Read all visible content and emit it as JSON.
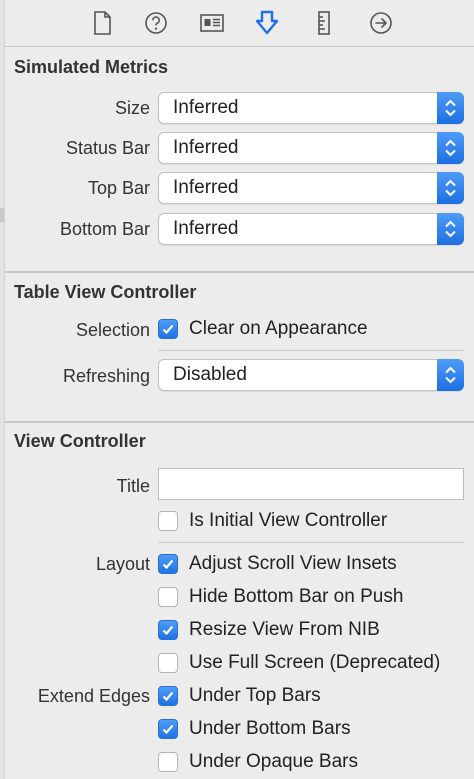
{
  "toolbar": {
    "icons": [
      "file-icon",
      "help-icon",
      "identity-icon",
      "attributes-icon",
      "size-icon",
      "connections-icon"
    ],
    "active_index": 3,
    "accent": "#1f6fe5"
  },
  "simulated_metrics": {
    "title": "Simulated Metrics",
    "rows": [
      {
        "label": "Size",
        "value": "Inferred"
      },
      {
        "label": "Status Bar",
        "value": "Inferred"
      },
      {
        "label": "Top Bar",
        "value": "Inferred"
      },
      {
        "label": "Bottom Bar",
        "value": "Inferred"
      }
    ]
  },
  "table_view_controller": {
    "title": "Table View Controller",
    "selection_label": "Selection",
    "clear_on_appearance": {
      "label": "Clear on Appearance",
      "checked": true
    },
    "refreshing_label": "Refreshing",
    "refreshing_value": "Disabled"
  },
  "view_controller": {
    "title": "View Controller",
    "title_label": "Title",
    "title_value": "",
    "is_initial": {
      "label": "Is Initial View Controller",
      "checked": false
    },
    "layout_label": "Layout",
    "layout_options": [
      {
        "label": "Adjust Scroll View Insets",
        "checked": true
      },
      {
        "label": "Hide Bottom Bar on Push",
        "checked": false
      },
      {
        "label": "Resize View From NIB",
        "checked": true
      },
      {
        "label": "Use Full Screen (Deprecated)",
        "checked": false
      }
    ],
    "extend_edges_label": "Extend Edges",
    "extend_edges_options": [
      {
        "label": "Under Top Bars",
        "checked": true
      },
      {
        "label": "Under Bottom Bars",
        "checked": true
      },
      {
        "label": "Under Opaque Bars",
        "checked": false
      }
    ]
  }
}
